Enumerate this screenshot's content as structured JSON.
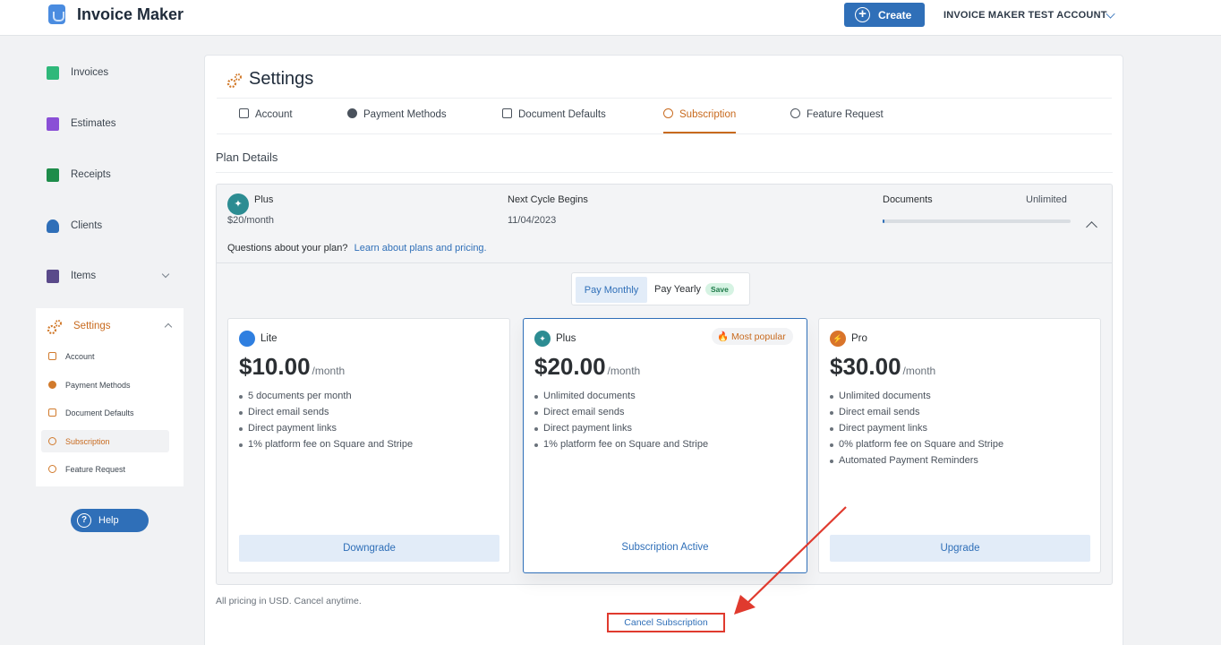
{
  "header": {
    "app_title": "Invoice Maker",
    "create_label": "Create",
    "account_name": "INVOICE MAKER TEST ACCOUNT"
  },
  "sidebar": {
    "items": [
      {
        "label": "Invoices",
        "icon": "invoice-icon",
        "color": "#2fb87a"
      },
      {
        "label": "Estimates",
        "icon": "estimate-icon",
        "color": "#8a4fd6"
      },
      {
        "label": "Receipts",
        "icon": "receipt-icon",
        "color": "#1e8c4a"
      },
      {
        "label": "Clients",
        "icon": "clients-icon",
        "color": "#2f6fb8"
      },
      {
        "label": "Items",
        "icon": "items-icon",
        "color": "#5a4a8a"
      }
    ],
    "settings": {
      "label": "Settings",
      "subitems": [
        {
          "label": "Account"
        },
        {
          "label": "Payment Methods"
        },
        {
          "label": "Document Defaults"
        },
        {
          "label": "Subscription"
        },
        {
          "label": "Feature Request"
        }
      ]
    },
    "help_label": "Help"
  },
  "main": {
    "title": "Settings",
    "tabs": [
      {
        "label": "Account"
      },
      {
        "label": "Payment Methods"
      },
      {
        "label": "Document Defaults"
      },
      {
        "label": "Subscription"
      },
      {
        "label": "Feature Request"
      }
    ],
    "plan_details_title": "Plan Details",
    "summary": {
      "plan_name": "Plus",
      "plan_price": "$20/month",
      "next_cycle_label": "Next Cycle Begins",
      "next_cycle_date": "11/04/2023",
      "documents_label": "Documents",
      "documents_value": "Unlimited",
      "documents_progress": 0.01,
      "questions_text": "Questions about your plan?",
      "questions_link": "Learn about plans and pricing."
    },
    "billing_toggle": {
      "monthly_label": "Pay Monthly",
      "yearly_label": "Pay Yearly",
      "save_badge": "Save"
    },
    "plans": [
      {
        "name": "Lite",
        "price": "$10.00",
        "period": "/month",
        "color": "#2f7fe0",
        "features": [
          "5 documents per month",
          "Direct email sends",
          "Direct payment links",
          "1% platform fee on Square and Stripe"
        ],
        "action": "Downgrade"
      },
      {
        "name": "Plus",
        "price": "$20.00",
        "period": "/month",
        "color": "#2c8c92",
        "badge": "Most popular",
        "features": [
          "Unlimited documents",
          "Direct email sends",
          "Direct payment links",
          "1% platform fee on Square and Stripe"
        ],
        "status": "Subscription Active"
      },
      {
        "name": "Pro",
        "price": "$30.00",
        "period": "/month",
        "color": "#d9742a",
        "features": [
          "Unlimited documents",
          "Direct email sends",
          "Direct payment links",
          "0% platform fee on Square and Stripe",
          "Automated Payment Reminders"
        ],
        "action": "Upgrade"
      }
    ],
    "pricing_note": "All pricing in USD. Cancel anytime.",
    "cancel_label": "Cancel Subscription"
  }
}
